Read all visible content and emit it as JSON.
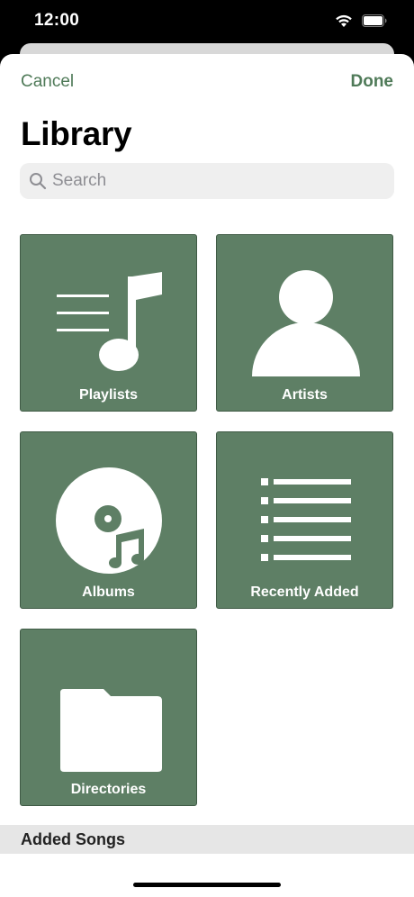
{
  "status_bar": {
    "time": "12:00"
  },
  "nav": {
    "cancel_label": "Cancel",
    "done_label": "Done"
  },
  "page": {
    "title": "Library"
  },
  "search": {
    "placeholder": "Search"
  },
  "tiles": [
    {
      "label": "Playlists",
      "icon": "music-note-list-icon"
    },
    {
      "label": "Artists",
      "icon": "person-icon"
    },
    {
      "label": "Albums",
      "icon": "album-disc-icon"
    },
    {
      "label": "Recently Added",
      "icon": "list-icon"
    },
    {
      "label": "Directories",
      "icon": "folder-icon"
    }
  ],
  "section": {
    "header": "Added Songs"
  },
  "colors": {
    "accent": "#4f7a58",
    "tile_bg": "#5e7f65",
    "tile_border": "#3f5a45"
  }
}
